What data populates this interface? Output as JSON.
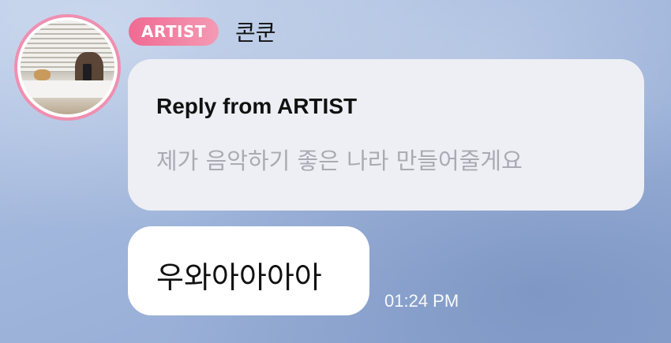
{
  "sender": {
    "badge": "ARTIST",
    "name": "콘쿤"
  },
  "reply": {
    "title": "Reply from ARTIST",
    "quoted_text": "제가 음악하기 좋은 나라 만들어줄게요"
  },
  "message": {
    "text": "우와아아아아",
    "time": "01:24 PM"
  },
  "colors": {
    "badge": "#f06a92",
    "avatar_ring": "#f08fb0",
    "reply_bubble": "#eeeff4",
    "message_bubble": "#ffffff",
    "quoted_text": "#a9abb3"
  }
}
